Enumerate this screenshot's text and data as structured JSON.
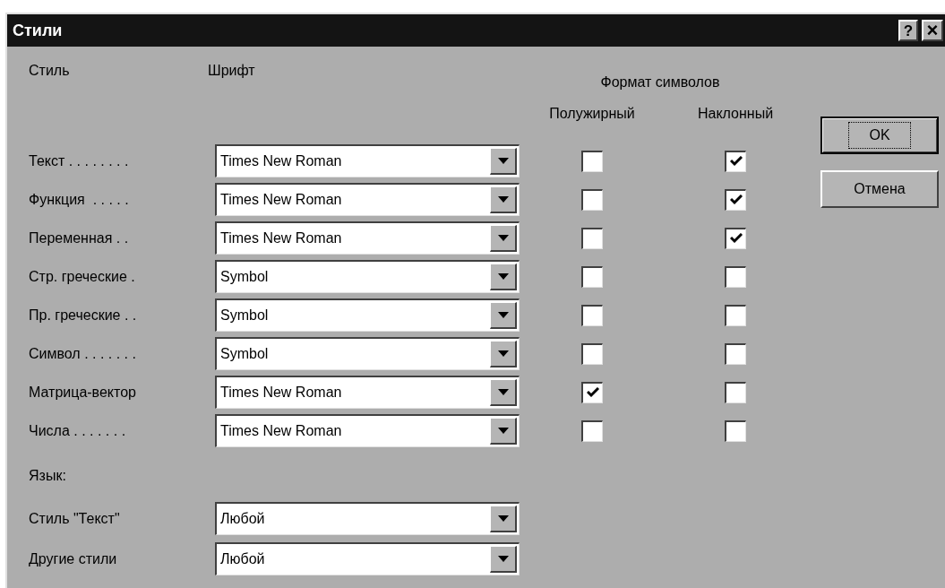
{
  "window": {
    "title": "Стили",
    "help_button": "?",
    "close_button": "×"
  },
  "headers": {
    "style": "Стиль",
    "font": "Шрифт",
    "format": "Формат символов",
    "bold": "Полужирный",
    "italic": "Наклонный"
  },
  "styles": [
    {
      "label": "Текст . . . . . . . .",
      "font": "Times New Roman",
      "bold": false,
      "italic": true
    },
    {
      "label": "Функция  . . . . .",
      "font": "Times New Roman",
      "bold": false,
      "italic": true
    },
    {
      "label": "Переменная . .",
      "font": "Times New Roman",
      "bold": false,
      "italic": true
    },
    {
      "label": "Стр. греческие .",
      "font": "Symbol",
      "bold": false,
      "italic": false
    },
    {
      "label": "Пр. греческие . .",
      "font": "Symbol",
      "bold": false,
      "italic": false
    },
    {
      "label": "Символ . . . . . . .",
      "font": "Symbol",
      "bold": false,
      "italic": false
    },
    {
      "label": "Матрица-вектор",
      "font": "Times New Roman",
      "bold": true,
      "italic": false
    },
    {
      "label": "Числа . . . . . . .",
      "font": "Times New Roman",
      "bold": false,
      "italic": false
    }
  ],
  "language": {
    "title": "Язык:",
    "rows": [
      {
        "label": "Стиль \"Текст\"",
        "value": "Любой"
      },
      {
        "label": "Другие стили",
        "value": "Любой"
      }
    ]
  },
  "buttons": [
    {
      "label": "OK",
      "default": true
    },
    {
      "label": "Отмена",
      "default": false
    }
  ]
}
